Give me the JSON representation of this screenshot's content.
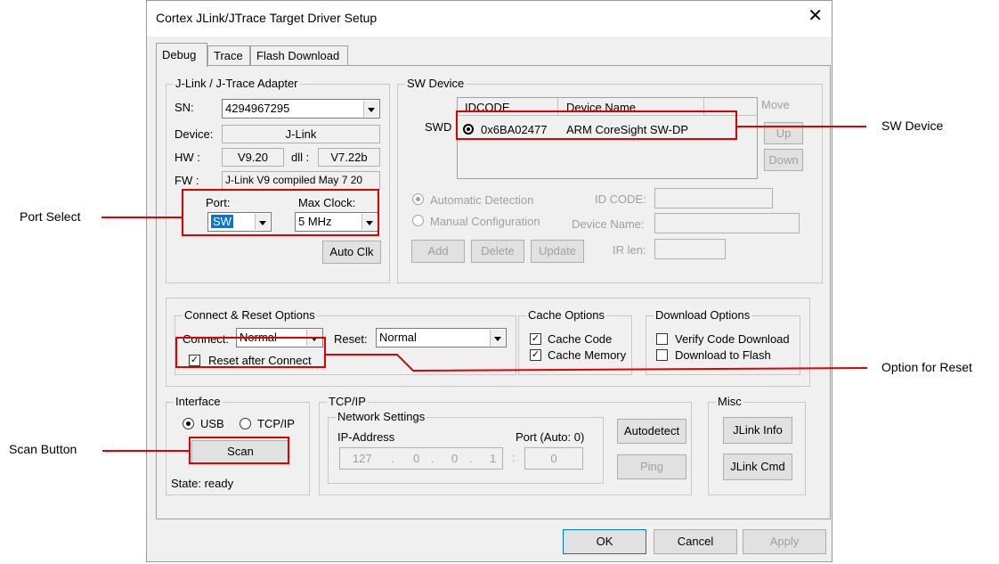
{
  "window": {
    "title": "Cortex JLink/JTrace Target Driver Setup",
    "close_glyph": "✕"
  },
  "tabs": [
    {
      "label": "Debug"
    },
    {
      "label": "Trace"
    },
    {
      "label": "Flash Download"
    }
  ],
  "adapter": {
    "group_label": "J-Link / J-Trace Adapter",
    "sn_label": "SN:",
    "sn_value": "4294967295",
    "device_label": "Device:",
    "device_value": "J-Link",
    "hw_label": "HW :",
    "hw_value": "V9.20",
    "dll_label": "dll :",
    "dll_value": "V7.22b",
    "fw_label": "FW :",
    "fw_value": "J-Link V9 compiled May  7 20",
    "port_label": "Port:",
    "port_value": "SW",
    "maxclock_label": "Max Clock:",
    "maxclock_value": "5 MHz",
    "autoclk_label": "Auto Clk"
  },
  "sw_device": {
    "group_label": "SW Device",
    "col_idcode": "IDCODE",
    "col_device_name": "Device Name",
    "swd_label": "SWD",
    "row": {
      "idcode": "0x6BA02477",
      "device_name": "ARM CoreSight SW-DP"
    },
    "move_label": "Move",
    "up_label": "Up",
    "down_label": "Down",
    "auto_detect_label": "Automatic Detection",
    "manual_config_label": "Manual Configuration",
    "id_code_label": "ID CODE:",
    "device_name_label": "Device Name:",
    "ir_len_label": "IR len:",
    "add_label": "Add",
    "delete_label": "Delete",
    "update_label": "Update"
  },
  "connect_reset": {
    "group_label": "Connect & Reset Options",
    "connect_label": "Connect:",
    "connect_value": "Normal",
    "reset_label": "Reset:",
    "reset_value": "Normal",
    "reset_after_connect_label": "Reset after Connect",
    "reset_after_connect_checked": true
  },
  "cache": {
    "group_label": "Cache Options",
    "cache_code_label": "Cache Code",
    "cache_memory_label": "Cache Memory"
  },
  "download": {
    "group_label": "Download Options",
    "verify_label": "Verify Code Download",
    "download_flash_label": "Download to Flash"
  },
  "interface": {
    "group_label": "Interface",
    "usb_label": "USB",
    "tcpip_label": "TCP/IP",
    "scan_label": "Scan",
    "state_label": "State: ready"
  },
  "tcpip": {
    "group_label": "TCP/IP",
    "network_label": "Network Settings",
    "ip_label": "IP-Address",
    "port_label": "Port (Auto: 0)",
    "ip_parts": [
      "127",
      "0",
      "0",
      "1"
    ],
    "port_value": "0",
    "autodetect_label": "Autodetect",
    "ping_label": "Ping"
  },
  "misc": {
    "group_label": "Misc",
    "jlink_info_label": "JLink Info",
    "jlink_cmd_label": "JLink Cmd"
  },
  "footer": {
    "ok_label": "OK",
    "cancel_label": "Cancel",
    "apply_label": "Apply"
  },
  "annotations": {
    "port_select": "Port Select",
    "sw_device": "SW Device",
    "option_reset": "Option for Reset",
    "scan_button": "Scan Button",
    "highlight_color": "#e00000"
  }
}
